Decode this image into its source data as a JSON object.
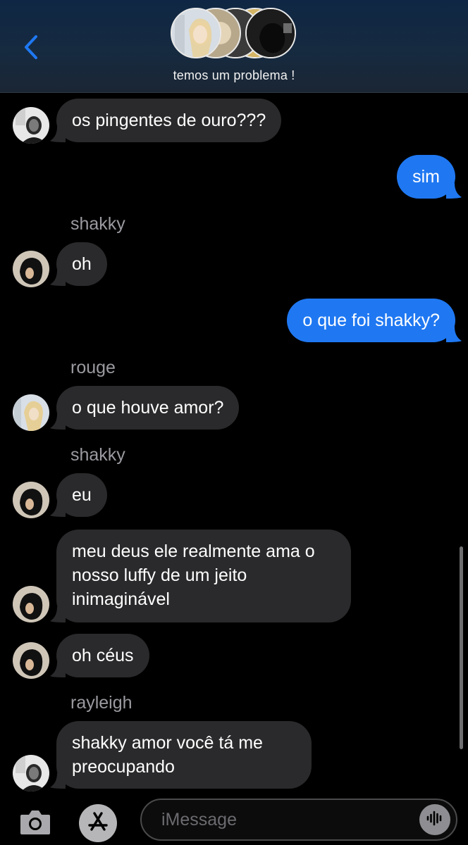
{
  "header": {
    "group_name": "temos um problema !",
    "back_icon": "chevron-left-icon",
    "accent_color": "#1f78f2"
  },
  "messages": [
    {
      "id": "m1",
      "direction": "incoming",
      "sender_name": "",
      "text": "os pingentes de ouro???",
      "avatar": "rayleigh"
    },
    {
      "id": "m2",
      "direction": "outgoing",
      "text": "sim"
    },
    {
      "id": "m3",
      "direction": "incoming",
      "sender_name": "shakky",
      "text": "oh",
      "avatar": "shakky"
    },
    {
      "id": "m4",
      "direction": "outgoing",
      "text": "o que foi shakky?"
    },
    {
      "id": "m5",
      "direction": "incoming",
      "sender_name": "rouge",
      "text": "o que houve amor?",
      "avatar": "rouge"
    },
    {
      "id": "m6",
      "direction": "incoming",
      "sender_name": "shakky",
      "text": "eu",
      "avatar": "shakky"
    },
    {
      "id": "m7",
      "direction": "incoming",
      "sender_name": "",
      "text": "meu deus ele realmente ama o nosso luffy de um jeito inimaginável",
      "avatar": "shakky"
    },
    {
      "id": "m8",
      "direction": "incoming",
      "sender_name": "",
      "text": "oh céus",
      "avatar": "shakky"
    },
    {
      "id": "m9",
      "direction": "incoming",
      "sender_name": "rayleigh",
      "text": "shakky amor você tá me preocupando",
      "avatar": "rayleigh"
    }
  ],
  "composer": {
    "placeholder": "iMessage",
    "camera_icon": "camera-icon",
    "apps_icon": "app-store-icon",
    "mic_icon": "audio-waveform-icon"
  },
  "colors": {
    "incoming_bubble": "#2a2a2c",
    "outgoing_bubble": "#1f78f2",
    "sender_label": "#9a9aa0"
  }
}
